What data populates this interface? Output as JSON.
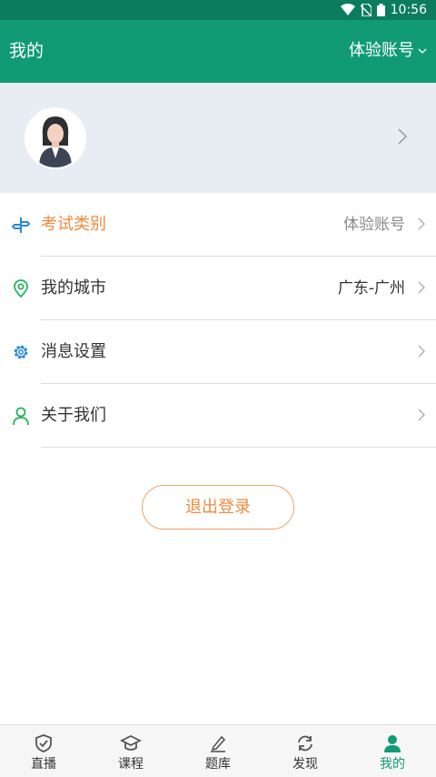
{
  "status_bar": {
    "time": "10:56"
  },
  "app_bar": {
    "title": "我的",
    "account_label": "体验账号"
  },
  "menu": [
    {
      "label": "考试类别",
      "value": "体验账号",
      "label_color": "#f08a3e"
    },
    {
      "label": "我的城市",
      "value": "广东-广州"
    },
    {
      "label": "消息设置",
      "value": ""
    },
    {
      "label": "关于我们",
      "value": ""
    }
  ],
  "logout_label": "退出登录",
  "tabs": [
    {
      "label": "直播",
      "icon": "shield-check-icon"
    },
    {
      "label": "课程",
      "icon": "graduation-cap-icon"
    },
    {
      "label": "题库",
      "icon": "pencil-icon"
    },
    {
      "label": "发现",
      "icon": "refresh-icon"
    },
    {
      "label": "我的",
      "icon": "person-icon",
      "active": true
    }
  ],
  "colors": {
    "primary": "#109b74",
    "status_bar": "#0b7d5c",
    "accent": "#f08a3e",
    "profile_bg": "#e7edf2"
  }
}
